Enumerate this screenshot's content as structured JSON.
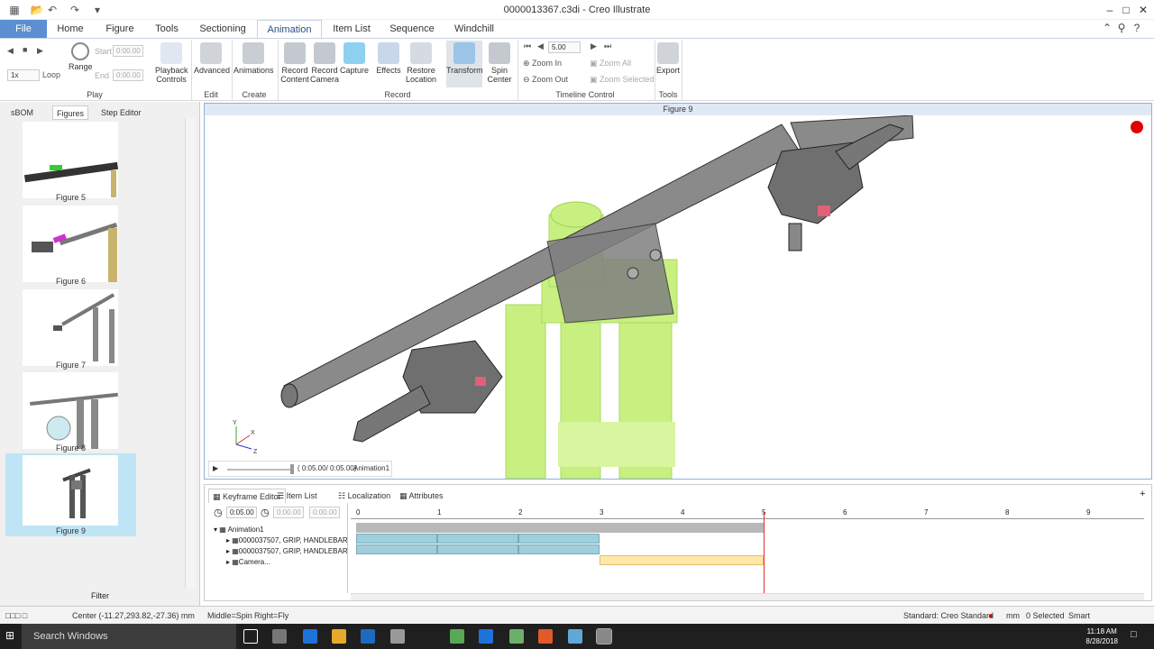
{
  "window": {
    "title": "0000013367.c3di - Creo Illustrate"
  },
  "menu_tabs": [
    "File",
    "Home",
    "Figure",
    "Tools",
    "Sectioning",
    "Animation",
    "Item List",
    "Sequence",
    "Windchill"
  ],
  "ribbon": {
    "play": {
      "start_label": "Start",
      "end_label": "End",
      "start_value": "0:00.00",
      "end_value": "0:00.00",
      "speed": "1x",
      "loop": "Loop",
      "range": "Range",
      "playback_controls": "Playback Controls",
      "group": "Play"
    },
    "edit": {
      "advanced": "Advanced",
      "group": "Edit"
    },
    "create": {
      "animations": "Animations",
      "group": "Create"
    },
    "record": {
      "record_content": "Record Content",
      "record_camera": "Record Camera",
      "capture": "Capture",
      "effects": "Effects",
      "restore_location": "Restore Location",
      "transform": "Transform",
      "spin_center": "Spin Center",
      "group": "Record"
    },
    "timeline": {
      "time_value": "5.00",
      "zoom_in": "Zoom In",
      "zoom_out": "Zoom Out",
      "zoom_all": "Zoom All",
      "zoom_selected": "Zoom Selected",
      "group": "Timeline Control"
    },
    "tools": {
      "export": "Export",
      "group": "Tools"
    }
  },
  "left_panel": {
    "tabs": [
      "sBOM",
      "Figures",
      "Step Editor"
    ],
    "figures": [
      "Figure 5",
      "Figure 6",
      "Figure 7",
      "Figure 8",
      "Figure 9"
    ],
    "filter": "Filter"
  },
  "viewport": {
    "title": "Figure 9",
    "time": "( 0:05.00/ 0:05.00)",
    "animation": "Animation1",
    "axis_y": "Y",
    "axis_x": "X",
    "axis_z": "Z"
  },
  "bottom_panel": {
    "tabs": [
      "Keyframe Editor",
      "Item List",
      "Localization",
      "Attributes"
    ],
    "time_value": "0:05.00",
    "time_value2": "0:00.00",
    "time_value3": "0:00.00",
    "tree": [
      "Animation1",
      "0000037507, GRIP, HANDLEBAR",
      "0000037507, GRIP, HANDLEBAR",
      "Camera..."
    ],
    "ruler": [
      "0",
      "1",
      "2",
      "3",
      "4",
      "5",
      "6",
      "7",
      "8",
      "9"
    ]
  },
  "status": {
    "center": "Center (-11.27,293.82,-27.36) mm",
    "middle": "Middle=Spin",
    "right": "Right=Fly",
    "standard": "Standard: Creo Standard",
    "units": "mm",
    "selected": "0 Selected",
    "mode": "Smart"
  },
  "taskbar": {
    "search": "Search Windows",
    "time": "11:18 AM",
    "date": "8/28/2018"
  },
  "colors": {
    "accent": "#5b8fd1",
    "highlight": "#bfe4f6",
    "model_green": "#c6f07a",
    "bar_blue": "#9fcfdc",
    "bar_orange": "#fde7a9",
    "record_red": "#e00000"
  }
}
